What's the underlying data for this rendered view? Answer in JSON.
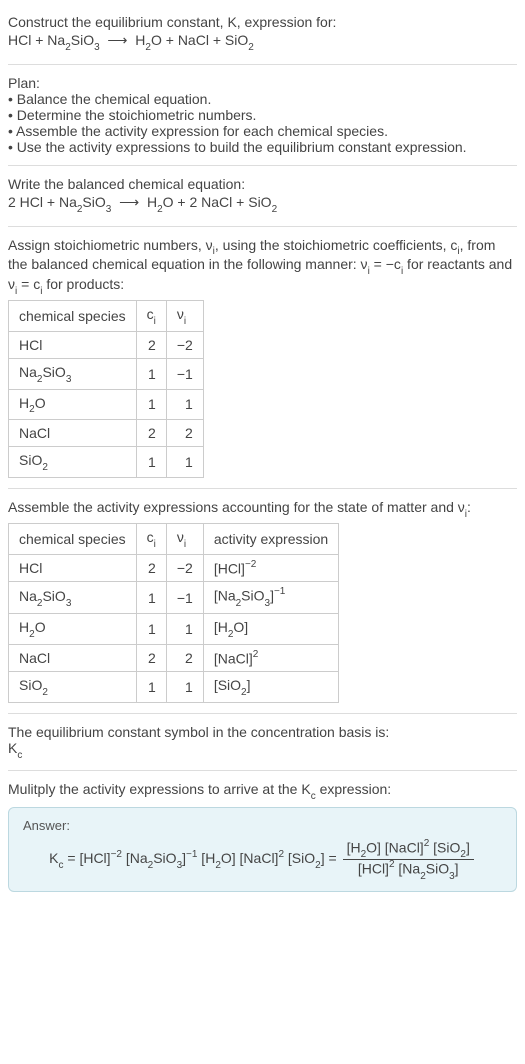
{
  "intro": {
    "line1": "Construct the equilibrium constant, K, expression for:",
    "line2_html": "HCl + Na<span class='sub'>2</span>SiO<span class='sub'>3</span> &nbsp;⟶&nbsp; H<span class='sub'>2</span>O + NaCl + SiO<span class='sub'>2</span>"
  },
  "plan": {
    "heading": "Plan:",
    "items": [
      "• Balance the chemical equation.",
      "• Determine the stoichiometric numbers.",
      "• Assemble the activity expression for each chemical species.",
      "• Use the activity expressions to build the equilibrium constant expression."
    ]
  },
  "balanced": {
    "heading": "Write the balanced chemical equation:",
    "eq_html": "2 HCl + Na<span class='sub'>2</span>SiO<span class='sub'>3</span> &nbsp;⟶&nbsp; H<span class='sub'>2</span>O + 2 NaCl + SiO<span class='sub'>2</span>"
  },
  "assign": {
    "text_html": "Assign stoichiometric numbers, ν<span class='sub'>i</span>, using the stoichiometric coefficients, c<span class='sub'>i</span>, from the balanced chemical equation in the following manner: ν<span class='sub'>i</span> = −c<span class='sub'>i</span> for reactants and ν<span class='sub'>i</span> = c<span class='sub'>i</span> for products:"
  },
  "table1": {
    "headers": {
      "species": "chemical species",
      "ci_html": "c<span class='sub'>i</span>",
      "vi_html": "ν<span class='sub'>i</span>"
    },
    "rows": [
      {
        "species_html": "HCl",
        "ci": "2",
        "vi": "−2"
      },
      {
        "species_html": "Na<span class='sub'>2</span>SiO<span class='sub'>3</span>",
        "ci": "1",
        "vi": "−1"
      },
      {
        "species_html": "H<span class='sub'>2</span>O",
        "ci": "1",
        "vi": "1"
      },
      {
        "species_html": "NaCl",
        "ci": "2",
        "vi": "2"
      },
      {
        "species_html": "SiO<span class='sub'>2</span>",
        "ci": "1",
        "vi": "1"
      }
    ]
  },
  "assemble_text_html": "Assemble the activity expressions accounting for the state of matter and ν<span class='sub'>i</span>:",
  "table2": {
    "headers": {
      "species": "chemical species",
      "ci_html": "c<span class='sub'>i</span>",
      "vi_html": "ν<span class='sub'>i</span>",
      "activity": "activity expression"
    },
    "rows": [
      {
        "species_html": "HCl",
        "ci": "2",
        "vi": "−2",
        "act_html": "[HCl]<span class='sup'>−2</span>"
      },
      {
        "species_html": "Na<span class='sub'>2</span>SiO<span class='sub'>3</span>",
        "ci": "1",
        "vi": "−1",
        "act_html": "[Na<span class='sub'>2</span>SiO<span class='sub'>3</span>]<span class='sup'>−1</span>"
      },
      {
        "species_html": "H<span class='sub'>2</span>O",
        "ci": "1",
        "vi": "1",
        "act_html": "[H<span class='sub'>2</span>O]"
      },
      {
        "species_html": "NaCl",
        "ci": "2",
        "vi": "2",
        "act_html": "[NaCl]<span class='sup'>2</span>"
      },
      {
        "species_html": "SiO<span class='sub'>2</span>",
        "ci": "1",
        "vi": "1",
        "act_html": "[SiO<span class='sub'>2</span>]"
      }
    ]
  },
  "eq_symbol": {
    "line1": "The equilibrium constant symbol in the concentration basis is:",
    "line2_html": "K<span class='sub'>c</span>"
  },
  "multiply_text_html": "Mulitply the activity expressions to arrive at the K<span class='sub'>c</span> expression:",
  "answer": {
    "label": "Answer:",
    "lhs_html": "K<span class='sub'>c</span> = [HCl]<span class='sup'>−2</span> [Na<span class='sub'>2</span>SiO<span class='sub'>3</span>]<span class='sup'>−1</span> [H<span class='sub'>2</span>O] [NaCl]<span class='sup'>2</span> [SiO<span class='sub'>2</span>] = ",
    "num_html": "[H<span class='sub'>2</span>O] [NaCl]<span class='sup'>2</span> [SiO<span class='sub'>2</span>]",
    "den_html": "[HCl]<span class='sup'>2</span> [Na<span class='sub'>2</span>SiO<span class='sub'>3</span>]"
  }
}
